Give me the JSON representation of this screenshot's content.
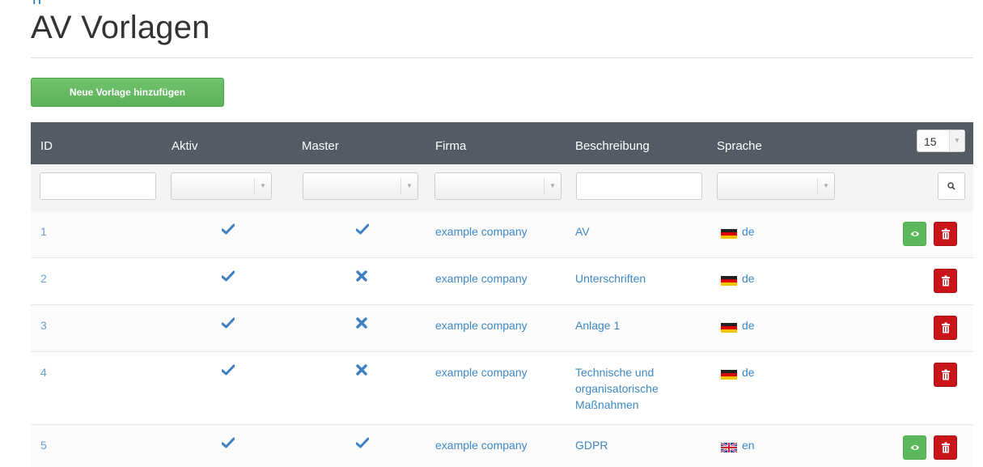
{
  "page": {
    "title": "AV Vorlagen",
    "add_button_label": "Neue Vorlage hinzufügen"
  },
  "table": {
    "columns": [
      "ID",
      "Aktiv",
      "Master",
      "Firma",
      "Beschreibung",
      "Sprache"
    ],
    "per_page": "15",
    "rows": [
      {
        "id": "1",
        "aktiv": true,
        "master": true,
        "firma": "example company",
        "beschreibung": "AV",
        "sprache": "de",
        "flag": "de-flag-icon",
        "actions": [
          "view",
          "delete"
        ]
      },
      {
        "id": "2",
        "aktiv": true,
        "master": false,
        "firma": "example company",
        "beschreibung": "Unterschriften",
        "sprache": "de",
        "flag": "de-flag-icon",
        "actions": [
          "delete"
        ]
      },
      {
        "id": "3",
        "aktiv": true,
        "master": false,
        "firma": "example company",
        "beschreibung": "Anlage 1",
        "sprache": "de",
        "flag": "de-flag-icon",
        "actions": [
          "delete"
        ]
      },
      {
        "id": "4",
        "aktiv": true,
        "master": false,
        "firma": "example company",
        "beschreibung": "Technische und organisatorische Maßnahmen",
        "sprache": "de",
        "flag": "de-flag-icon",
        "actions": [
          "delete"
        ]
      },
      {
        "id": "5",
        "aktiv": true,
        "master": true,
        "firma": "example company",
        "beschreibung": "GDPR",
        "sprache": "en",
        "flag": "uk-flag-icon",
        "actions": [
          "view",
          "delete"
        ]
      }
    ]
  },
  "icons": {
    "check": "check-icon",
    "cross": "cross-icon",
    "view": "eye-icon",
    "delete": "trash-icon",
    "search": "search-icon"
  },
  "colors": {
    "header_bg": "#535c65",
    "link_blue": "#3d88c4",
    "success_green": "#5cb85c",
    "danger_red": "#c9141a"
  }
}
